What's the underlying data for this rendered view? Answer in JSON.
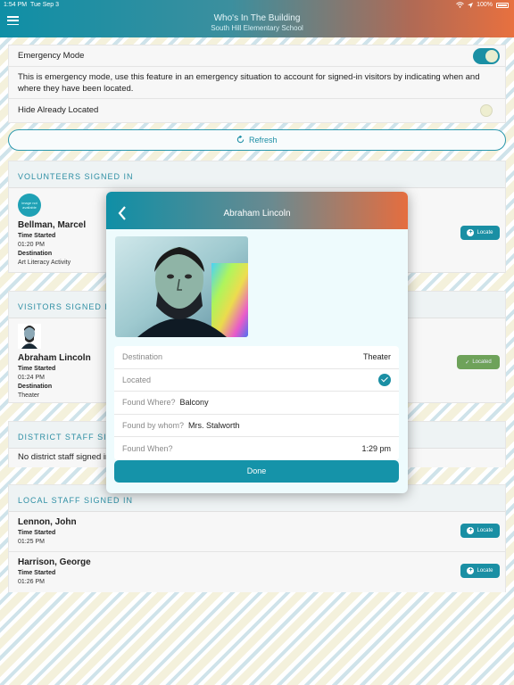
{
  "status_bar": {
    "time": "1:54 PM",
    "date": "Tue Sep 3",
    "battery": "100%"
  },
  "header": {
    "title": "Who's In The Building",
    "subtitle": "South Hill Elementary School"
  },
  "emergency": {
    "mode_label": "Emergency Mode",
    "description": "This is emergency mode, use this feature in an emergency situation to account for signed-in visitors by indicating when and where they have been located.",
    "hide_label": "Hide Already Located"
  },
  "refresh_label": "Refresh",
  "volunteers": {
    "heading": "VOLUNTEERS SIGNED IN",
    "items": [
      {
        "avatar_text": "image not available",
        "name": "Bellman, Marcel",
        "time_label": "Time Started",
        "time": "01:20 PM",
        "dest_label": "Destination",
        "destination": "Art Literacy Activity",
        "action": "Locate"
      }
    ]
  },
  "visitors": {
    "heading": "VISITORS SIGNED IN",
    "items": [
      {
        "name": "Abraham Lincoln",
        "time_label": "Time Started",
        "time": "01:24 PM",
        "dest_label": "Destination",
        "destination": "Theater",
        "action": "Located"
      }
    ]
  },
  "district": {
    "heading": "DISTRICT STAFF SIGNED IN",
    "empty": "No district staff signed in"
  },
  "local": {
    "heading": "LOCAL STAFF SIGNED IN",
    "items": [
      {
        "name": "Lennon, John",
        "time_label": "Time Started",
        "time": "01:25 PM",
        "action": "Locate"
      },
      {
        "name": "Harrison, George",
        "time_label": "Time Started",
        "time": "01:26 PM",
        "action": "Locate"
      }
    ]
  },
  "modal": {
    "title": "Abraham Lincoln",
    "fields": {
      "destination_label": "Destination",
      "destination": "Theater",
      "located_label": "Located",
      "found_where_label": "Found Where?",
      "found_where": "Balcony",
      "found_by_label": "Found by whom?",
      "found_by": "Mrs. Stalworth",
      "found_when_label": "Found When?",
      "found_when": "1:29 pm"
    },
    "done_label": "Done"
  },
  "colors": {
    "accent": "#1a8fa4",
    "located": "#6ea25a",
    "header_end": "#e8703f"
  }
}
